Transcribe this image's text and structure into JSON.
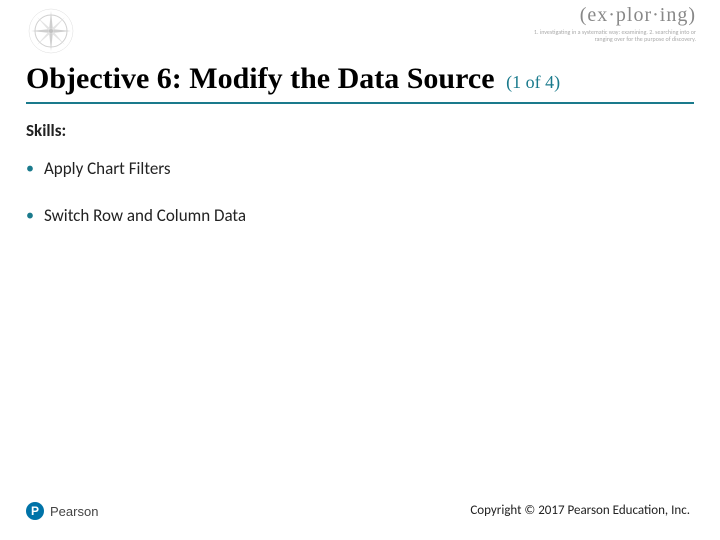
{
  "brand": {
    "main": "(ex·plor·ing)",
    "sub": "1. investigating in a systematic way: examining. 2. searching into or ranging over for the purpose of discovery."
  },
  "title": {
    "main": "Objective 6: Modify the Data Source",
    "count": "(1 of 4)"
  },
  "skills_label": "Skills:",
  "bullets": [
    "Apply Chart Filters",
    "Switch Row and Column Data"
  ],
  "footer": {
    "logo_letter": "P",
    "logo_text": "Pearson",
    "copyright": "Copyright © 2017 Pearson Education, Inc."
  }
}
